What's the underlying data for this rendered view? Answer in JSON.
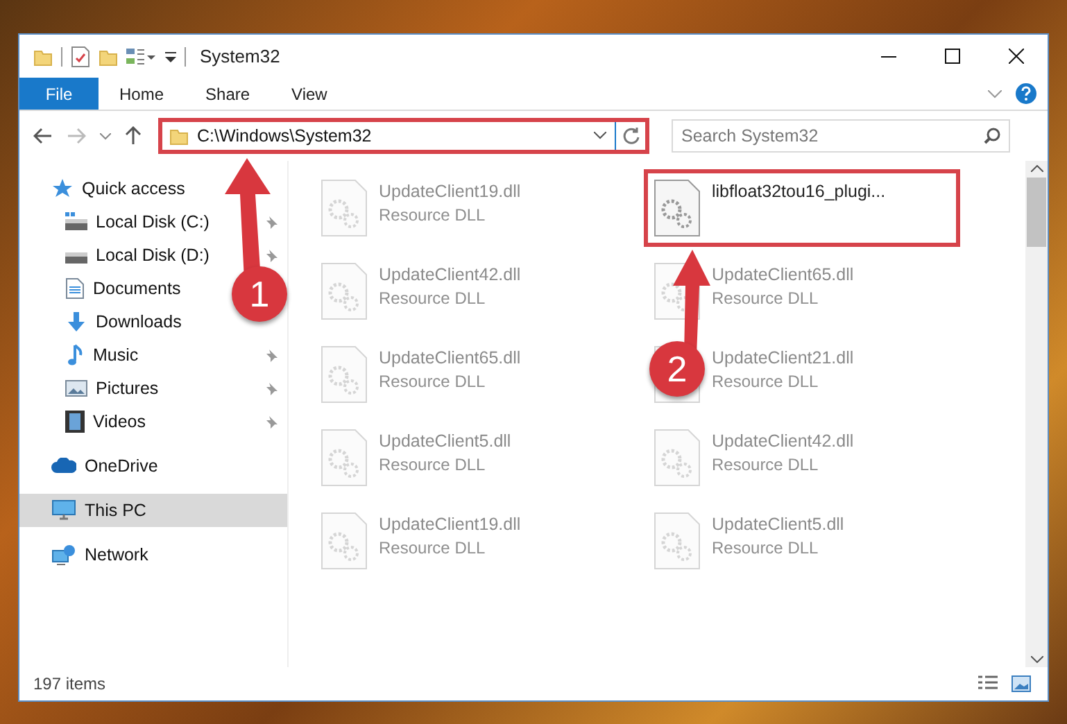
{
  "window": {
    "title": "System32"
  },
  "ribbon_tabs": [
    {
      "label": "File",
      "kind": "file",
      "selected": false
    },
    {
      "label": "Home",
      "kind": "tab",
      "selected": false
    },
    {
      "label": "Share",
      "kind": "tab",
      "selected": false
    },
    {
      "label": "View",
      "kind": "tab",
      "selected": false
    }
  ],
  "address": {
    "value": "C:\\Windows\\System32",
    "highlighted": true
  },
  "search": {
    "placeholder": "Search System32"
  },
  "sidebar": {
    "items": [
      {
        "label": "Quick access",
        "kind": "star",
        "selected": false,
        "children": [
          {
            "label": "Local Disk (C:)",
            "kind": "system-drive",
            "pinned": true,
            "selected": false
          },
          {
            "label": "Local Disk (D:)",
            "kind": "drive",
            "pinned": true,
            "selected": false
          },
          {
            "label": "Documents",
            "kind": "documents",
            "pinned": false,
            "selected": false
          },
          {
            "label": "Downloads",
            "kind": "downloads",
            "pinned": false,
            "selected": false
          },
          {
            "label": "Music",
            "kind": "music",
            "pinned": true,
            "selected": false
          },
          {
            "label": "Pictures",
            "kind": "pictures",
            "pinned": true,
            "selected": false
          },
          {
            "label": "Videos",
            "kind": "videos",
            "pinned": true,
            "selected": false
          }
        ]
      },
      {
        "label": "OneDrive",
        "kind": "cloud",
        "selected": false
      },
      {
        "label": "This PC",
        "kind": "pc",
        "selected": true
      },
      {
        "label": "Network",
        "kind": "network",
        "selected": false
      }
    ]
  },
  "files": [
    {
      "name": "UpdateClient19.dll",
      "type": "Resource DLL",
      "faded": true,
      "selected": false
    },
    {
      "name": "libfloat32tou16_plugi...",
      "faded": false,
      "selected": true
    },
    {
      "name": "UpdateClient42.dll",
      "type": "Resource DLL",
      "faded": true,
      "selected": false
    },
    {
      "name": "UpdateClient65.dll",
      "type": "Resource DLL",
      "faded": true,
      "selected": false
    },
    {
      "name": "UpdateClient65.dll",
      "type": "Resource DLL",
      "faded": true,
      "selected": false
    },
    {
      "name": "UpdateClient21.dll",
      "type": "Resource DLL",
      "faded": true,
      "selected": false
    },
    {
      "name": "UpdateClient5.dll",
      "type": "Resource DLL",
      "faded": true,
      "selected": false
    },
    {
      "name": "UpdateClient42.dll",
      "type": "Resource DLL",
      "faded": true,
      "selected": false
    },
    {
      "name": "UpdateClient19.dll",
      "type": "Resource DLL",
      "faded": true,
      "selected": false
    },
    {
      "name": "UpdateClient5.dll",
      "type": "Resource DLL",
      "faded": true,
      "selected": false
    }
  ],
  "callouts": [
    {
      "label": "1"
    },
    {
      "label": "2"
    }
  ],
  "status_bar": {
    "count": "197 items"
  }
}
